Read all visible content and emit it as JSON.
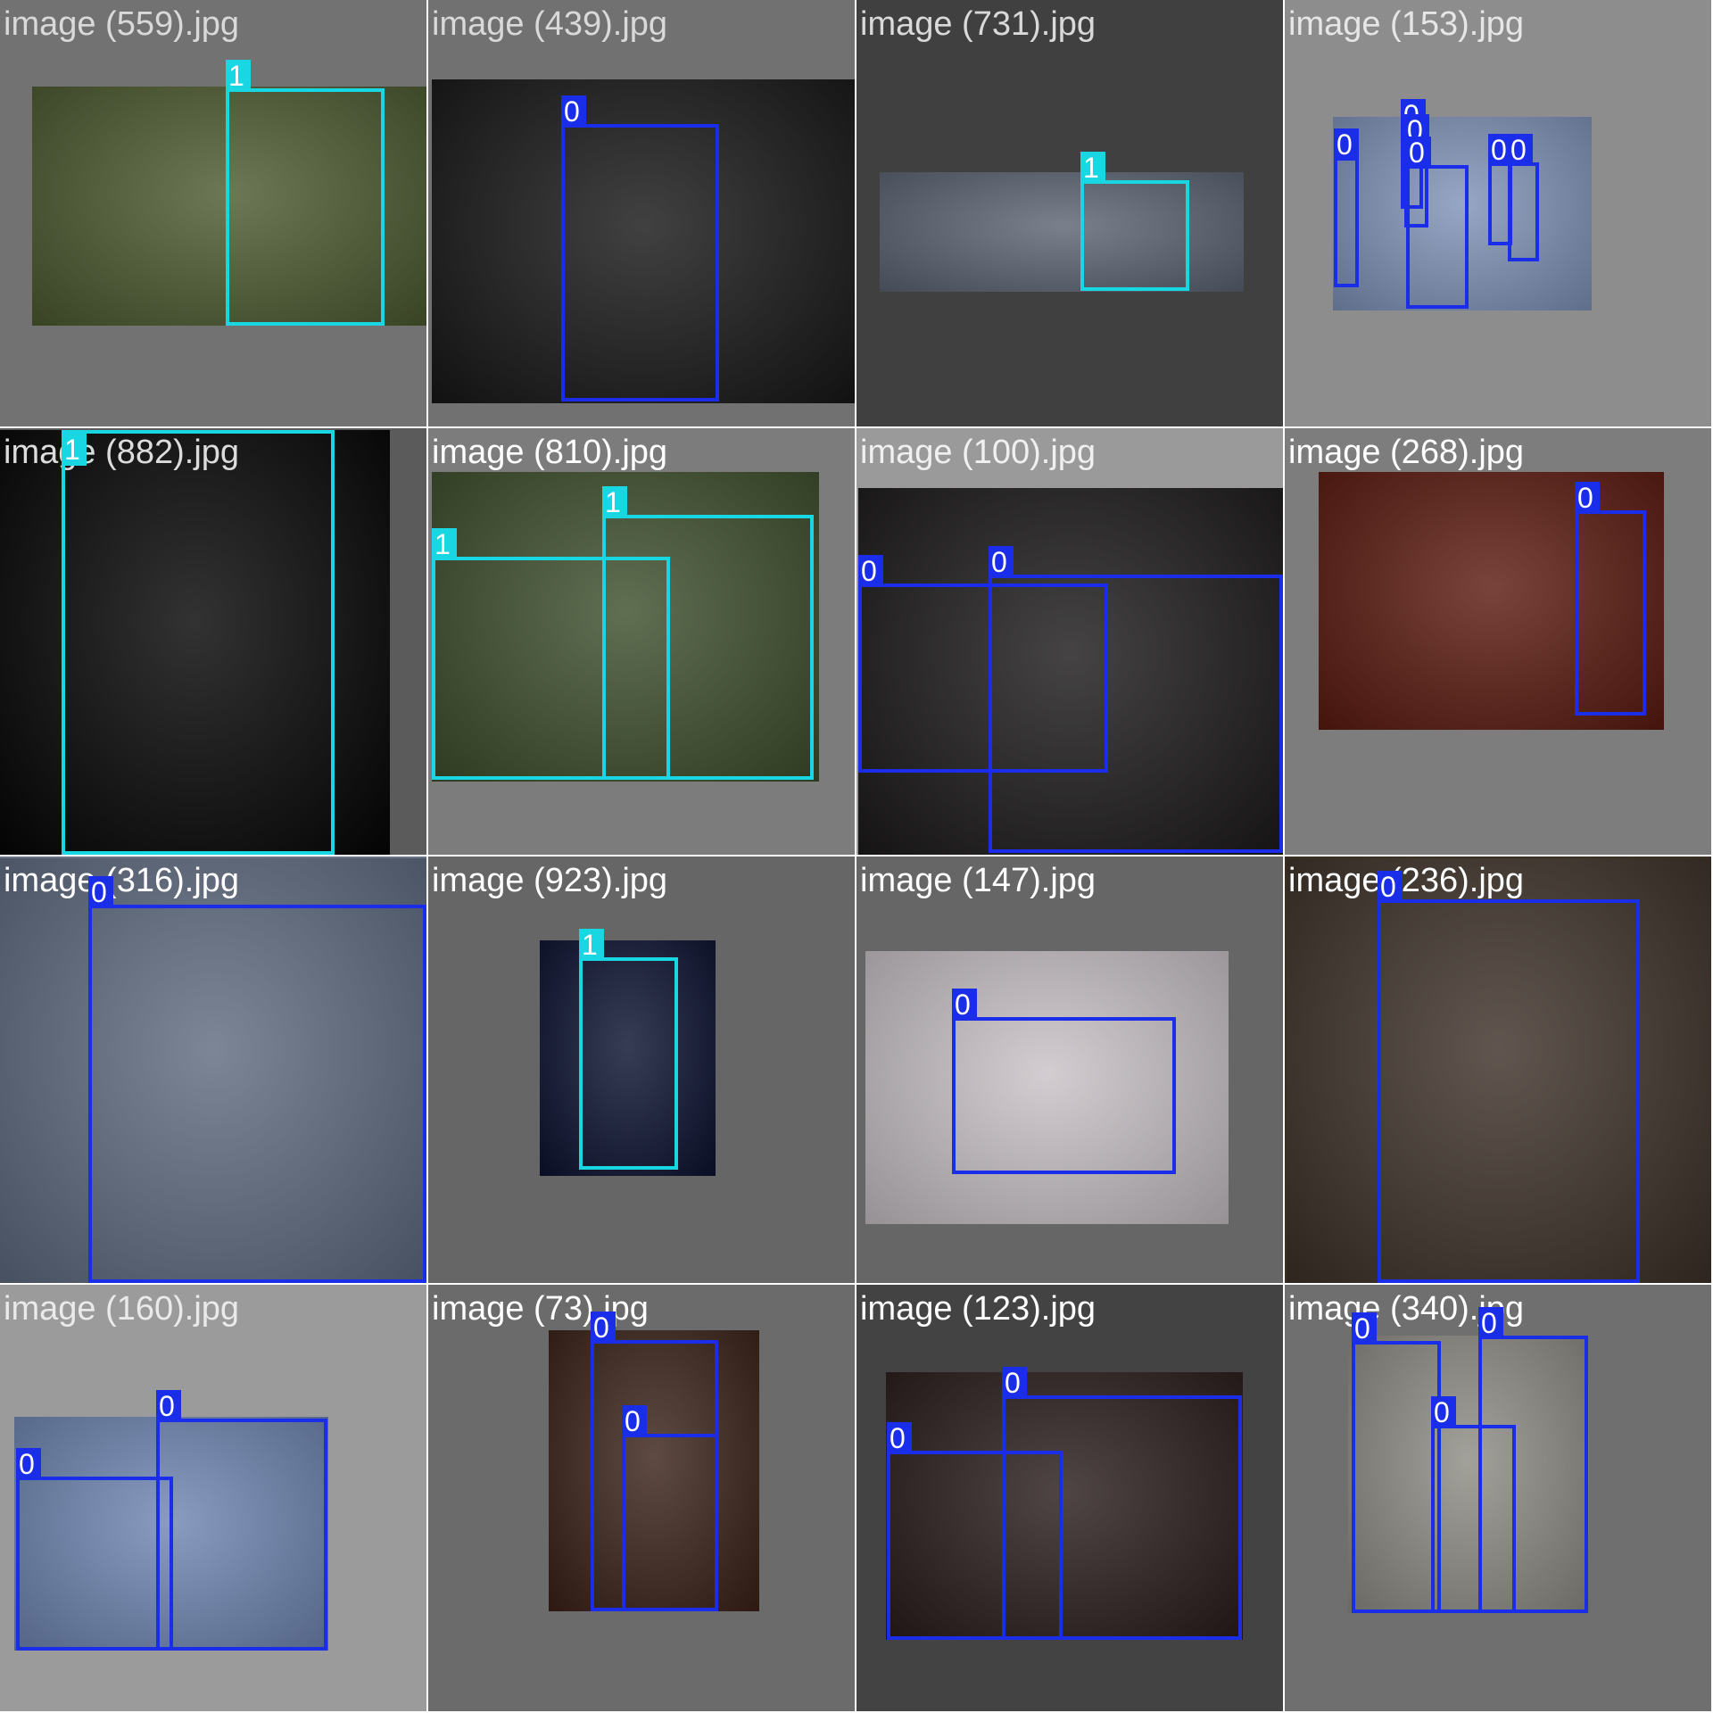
{
  "colors": {
    "class_0": "#1a2eea",
    "class_1": "#18d6e2"
  },
  "tiles": [
    {
      "label": "image (559).jpg",
      "bg": "#727272",
      "label_color": "#d9d9d9",
      "photo_bg": "#4c5a30",
      "boxes": [
        {
          "cls": "1",
          "color": "#18d6e2"
        }
      ]
    },
    {
      "label": "image (439).jpg",
      "bg": "#717171",
      "label_color": "#d9d9d9",
      "photo_bg": "#171717",
      "boxes": [
        {
          "cls": "0",
          "color": "#1a2eea"
        }
      ]
    },
    {
      "label": "image (731).jpg",
      "bg": "#404040",
      "label_color": "#d9d9d9",
      "photo_bg": "#5c6472",
      "boxes": [
        {
          "cls": "1",
          "color": "#18d6e2"
        }
      ]
    },
    {
      "label": "image (153).jpg",
      "bg": "#8d8d8d",
      "label_color": "#e6e6e6",
      "photo_bg": "#7f93b8",
      "boxes": [
        {
          "cls": "0",
          "color": "#1a2eea"
        },
        {
          "cls": "0",
          "color": "#1a2eea"
        },
        {
          "cls": "0",
          "color": "#1a2eea"
        },
        {
          "cls": "0",
          "color": "#1a2eea"
        },
        {
          "cls": "0",
          "color": "#1a2eea"
        },
        {
          "cls": "0",
          "color": "#1a2eea"
        }
      ]
    },
    {
      "label": "image (882).jpg",
      "bg": "#5b5b5b",
      "label_color": "#dcdcdc",
      "photo_bg": "#050505",
      "boxes": [
        {
          "cls": "1",
          "color": "#18d6e2"
        }
      ]
    },
    {
      "label": "image (810).jpg",
      "bg": "#7c7c7c",
      "label_color": "#ffffff",
      "photo_bg": "#3d4e2c",
      "boxes": [
        {
          "cls": "1",
          "color": "#18d6e2"
        },
        {
          "cls": "1",
          "color": "#18d6e2"
        }
      ]
    },
    {
      "label": "image (100).jpg",
      "bg": "#9a9a9a",
      "label_color": "#f0f0f0",
      "photo_bg": "#1c1a1a",
      "boxes": [
        {
          "cls": "0",
          "color": "#1a2eea"
        },
        {
          "cls": "0",
          "color": "#1a2eea"
        }
      ]
    },
    {
      "label": "image (268).jpg",
      "bg": "#7d7d7d",
      "label_color": "#ffffff",
      "photo_bg": "#5b1a10",
      "boxes": [
        {
          "cls": "0",
          "color": "#1a2eea"
        }
      ]
    },
    {
      "label": "image (316).jpg",
      "bg": "#6a7585",
      "label_color": "#ffffff",
      "photo_bg": "#5f6b80",
      "boxes": [
        {
          "cls": "0",
          "color": "#1a2eea"
        }
      ]
    },
    {
      "label": "image (923).jpg",
      "bg": "#666666",
      "label_color": "#ffffff",
      "photo_bg": "#0b1230",
      "boxes": [
        {
          "cls": "1",
          "color": "#18d6e2"
        }
      ]
    },
    {
      "label": "image (147).jpg",
      "bg": "#666666",
      "label_color": "#ffffff",
      "photo_bg": "#c9c2c6",
      "boxes": [
        {
          "cls": "0",
          "color": "#1a2eea"
        }
      ]
    },
    {
      "label": "image (236).jpg",
      "bg": "#3a3026",
      "label_color": "#ffffff",
      "photo_bg": "#3d3128",
      "boxes": [
        {
          "cls": "0",
          "color": "#1a2eea"
        }
      ]
    },
    {
      "label": "image (160).jpg",
      "bg": "#9b9b9b",
      "label_color": "#eaeaea",
      "photo_bg": "#6f86b2",
      "boxes": [
        {
          "cls": "0",
          "color": "#1a2eea"
        },
        {
          "cls": "0",
          "color": "#1a2eea"
        }
      ]
    },
    {
      "label": "image (73).jpg",
      "bg": "#6b6b6b",
      "label_color": "#ffffff",
      "photo_bg": "#3a2218",
      "boxes": [
        {
          "cls": "0",
          "color": "#1a2eea"
        },
        {
          "cls": "0",
          "color": "#1a2eea"
        }
      ]
    },
    {
      "label": "image (123).jpg",
      "bg": "#434343",
      "label_color": "#ffffff",
      "photo_bg": "#2a1c1c",
      "boxes": [
        {
          "cls": "0",
          "color": "#1a2eea"
        },
        {
          "cls": "0",
          "color": "#1a2eea"
        }
      ]
    },
    {
      "label": "image (340).jpg",
      "bg": "#6f6f6f",
      "label_color": "#ffffff",
      "photo_bg": "#8e8c84",
      "boxes": [
        {
          "cls": "0",
          "color": "#1a2eea"
        },
        {
          "cls": "0",
          "color": "#1a2eea"
        },
        {
          "cls": "0",
          "color": "#1a2eea"
        }
      ]
    }
  ]
}
